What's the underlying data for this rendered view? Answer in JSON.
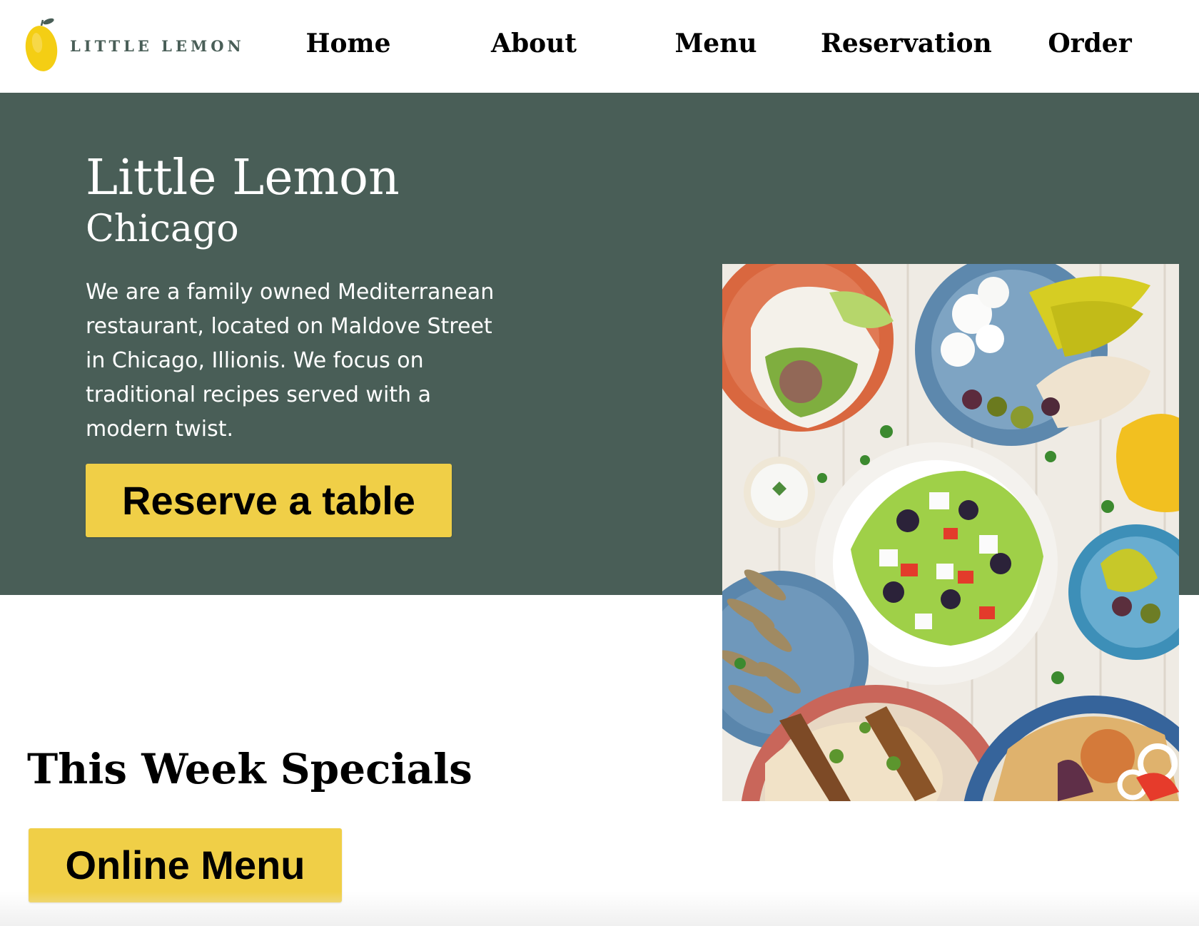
{
  "brand": {
    "logo_text": "LITTLE LEMON",
    "logo_color": "#495e57",
    "lemon_color": "#f4ce14"
  },
  "nav": {
    "items": [
      {
        "label": "Home"
      },
      {
        "label": "About"
      },
      {
        "label": "Menu"
      },
      {
        "label": "Reservation"
      },
      {
        "label": "Order"
      }
    ]
  },
  "hero": {
    "title": "Little Lemon",
    "subtitle": "Chicago",
    "description": "We are a family owned Mediterranean restaurant, located on Maldove Street in Chicago, Illionis. We focus on traditional recipes served with a modern twist.",
    "cta_label": "Reserve a table",
    "background_color": "#495e57",
    "button_color": "#f0cf47",
    "image_subject": "mediterranean-food-spread"
  },
  "specials": {
    "title": "This Week Specials",
    "cta_label": "Online Menu"
  }
}
